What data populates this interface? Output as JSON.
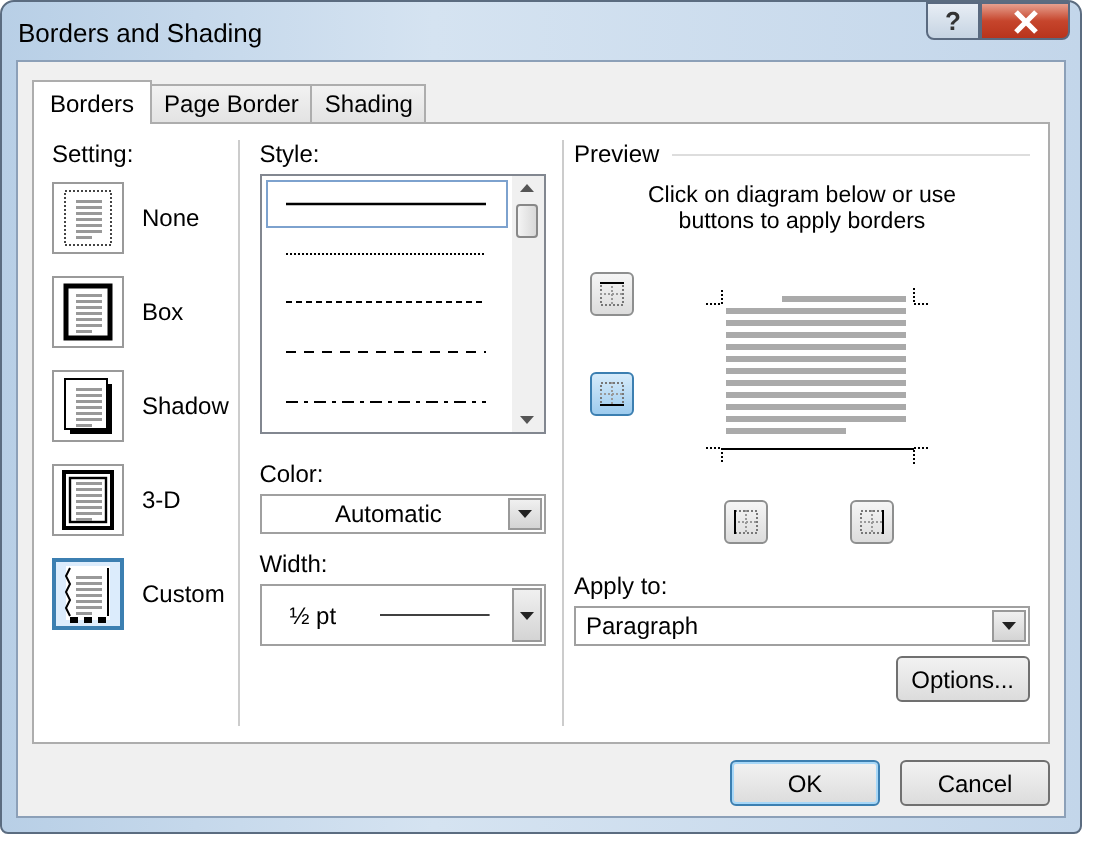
{
  "window": {
    "title": "Borders and Shading",
    "help": "?"
  },
  "tabs": [
    {
      "label": "Borders",
      "selected": true
    },
    {
      "label": "Page Border",
      "selected": false
    },
    {
      "label": "Shading",
      "selected": false
    }
  ],
  "setting": {
    "label": "Setting:",
    "items": [
      {
        "label": "None",
        "kind": "none",
        "selected": false
      },
      {
        "label": "Box",
        "kind": "box",
        "selected": false
      },
      {
        "label": "Shadow",
        "kind": "shadow",
        "selected": false
      },
      {
        "label": "3-D",
        "kind": "threed",
        "selected": false
      },
      {
        "label": "Custom",
        "kind": "custom",
        "selected": true
      }
    ]
  },
  "style": {
    "label": "Style:",
    "items": [
      {
        "kind": "solid",
        "selected": true
      },
      {
        "kind": "dotted",
        "selected": false
      },
      {
        "kind": "dashed",
        "selected": false
      },
      {
        "kind": "long-dash",
        "selected": false
      },
      {
        "kind": "dash-dot",
        "selected": false
      }
    ]
  },
  "color": {
    "label": "Color:",
    "value": "Automatic"
  },
  "width": {
    "label": "Width:",
    "value": "½ pt"
  },
  "preview": {
    "label": "Preview",
    "hint": "Click on diagram below or use buttons to apply borders",
    "buttons": [
      {
        "kind": "top",
        "selected": false
      },
      {
        "kind": "bottom",
        "selected": true
      },
      {
        "kind": "left",
        "selected": false
      },
      {
        "kind": "right",
        "selected": false
      }
    ]
  },
  "apply_to": {
    "label": "Apply to:",
    "value": "Paragraph"
  },
  "buttons": [
    {
      "label": "Options...",
      "kind": "options"
    },
    {
      "label": "OK",
      "kind": "default"
    },
    {
      "label": "Cancel",
      "kind": "normal"
    }
  ]
}
